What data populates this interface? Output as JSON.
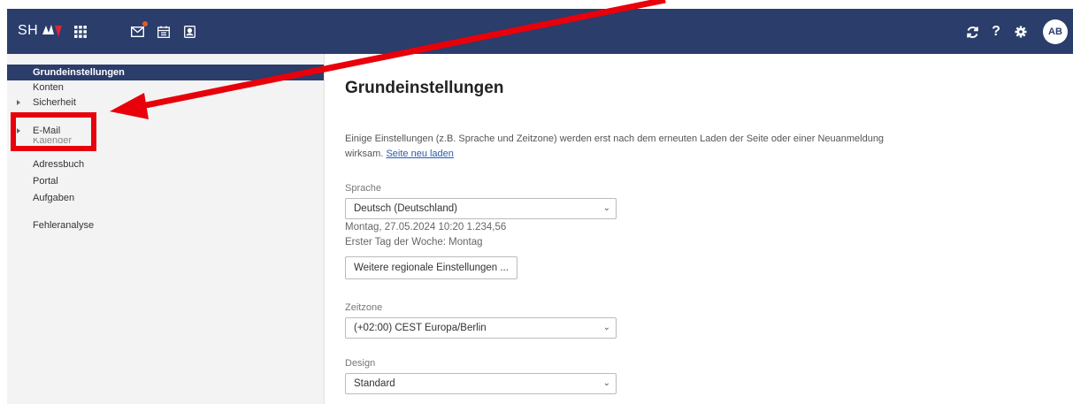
{
  "topbar": {
    "logo_text": "SH",
    "icons": [
      "apps-grid-icon",
      "mail-icon",
      "calendar-icon",
      "address-book-icon"
    ],
    "right_icons": [
      "refresh-icon",
      "help-icon",
      "settings-icon"
    ],
    "help_glyph": "?",
    "avatar_initials": "AB"
  },
  "sidebar": {
    "items": [
      {
        "label": "Grundeinstellungen",
        "active": true
      },
      {
        "label": "Konten"
      },
      {
        "label": "Sicherheit",
        "expandable": true
      },
      {
        "label": "E-Mail",
        "expandable": true
      },
      {
        "label": "Kalender"
      },
      {
        "label": "Adressbuch"
      },
      {
        "label": "Portal"
      },
      {
        "label": "Aufgaben"
      },
      {
        "label": "Fehleranalyse"
      }
    ]
  },
  "main": {
    "title": "Grundeinstellungen",
    "info_text": "Einige Einstellungen (z.B. Sprache und Zeitzone) werden erst nach dem erneuten Laden der Seite oder einer Neuanmeldung wirksam.",
    "reload_link": "Seite neu laden",
    "language": {
      "label": "Sprache",
      "value": "Deutsch (Deutschland)",
      "example_datetime": "Montag, 27.05.2024 10:20   1.234,56",
      "first_day": "Erster Tag der Woche: Montag",
      "regional_button": "Weitere regionale Einstellungen ..."
    },
    "timezone": {
      "label": "Zeitzone",
      "value": "(+02:00) CEST Europa/Berlin"
    },
    "design": {
      "label": "Design",
      "value": "Standard"
    }
  },
  "annotation": {
    "highlight_color": "#e8000b",
    "arrow_color": "#e8000b"
  }
}
